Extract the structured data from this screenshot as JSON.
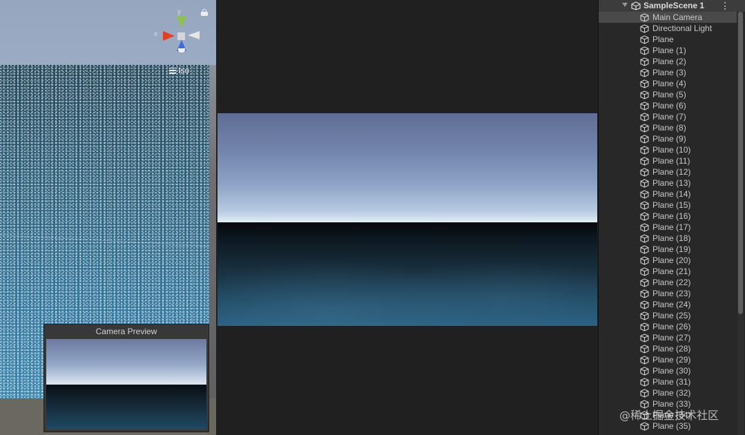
{
  "scene_view": {
    "gizmo": {
      "y_label": "y",
      "x_label": "x"
    },
    "projection_label": "Iso",
    "camera_preview_title": "Camera Preview"
  },
  "hierarchy": {
    "scene_name": "SampleScene 1",
    "items": [
      "Main Camera",
      "Directional Light",
      "Plane",
      "Plane (1)",
      "Plane (2)",
      "Plane (3)",
      "Plane (4)",
      "Plane (5)",
      "Plane (6)",
      "Plane (7)",
      "Plane (8)",
      "Plane (9)",
      "Plane (10)",
      "Plane (11)",
      "Plane (12)",
      "Plane (13)",
      "Plane (14)",
      "Plane (15)",
      "Plane (16)",
      "Plane (17)",
      "Plane (18)",
      "Plane (19)",
      "Plane (20)",
      "Plane (21)",
      "Plane (22)",
      "Plane (23)",
      "Plane (24)",
      "Plane (25)",
      "Plane (26)",
      "Plane (27)",
      "Plane (28)",
      "Plane (29)",
      "Plane (30)",
      "Plane (31)",
      "Plane (32)",
      "Plane (33)",
      "Plane (34)",
      "Plane (35)"
    ],
    "selected_index": 0
  },
  "watermark": "@稀土掘金技术社区",
  "colors": {
    "gizmo_x": "#e33f20",
    "gizmo_y": "#8bc24a",
    "gizmo_z": "#3a6be0",
    "selection": "#4a4a4a",
    "panel_bg": "#282828"
  },
  "icons": {
    "lock": "lock-icon",
    "menu": "menu-icon",
    "unity_scene": "unity-scene-icon",
    "game_object": "cube-icon",
    "more": "more-vertical-icon",
    "fold": "chevron-down-icon"
  }
}
